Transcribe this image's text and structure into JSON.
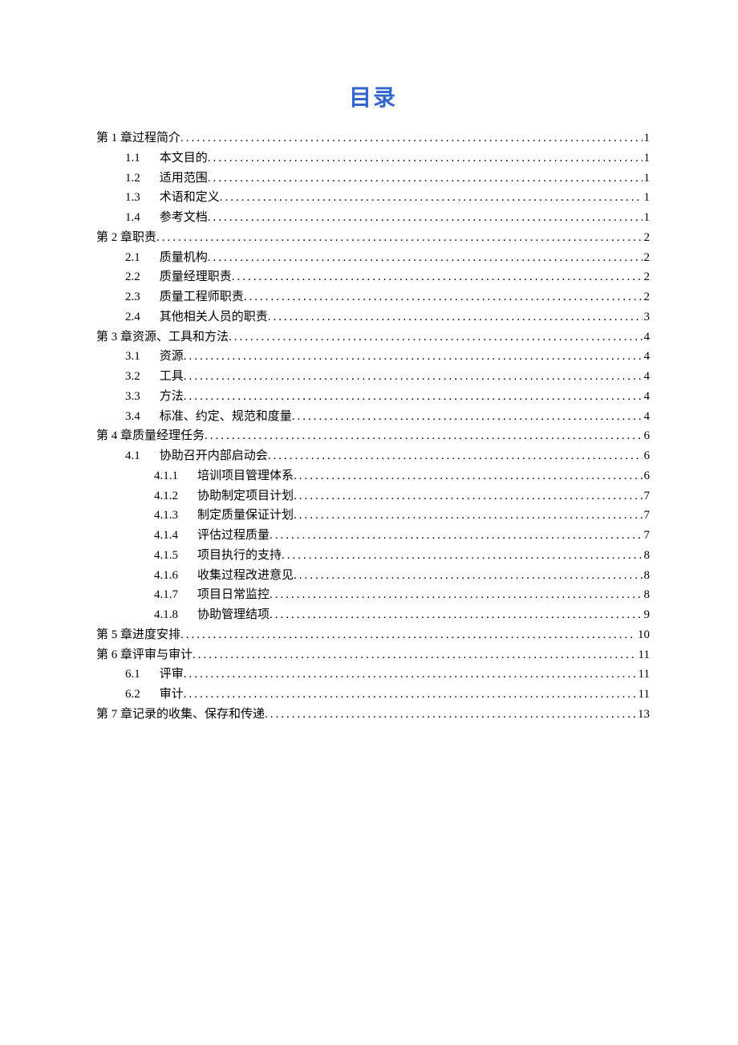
{
  "title": "目录",
  "entries": [
    {
      "level": 1,
      "num": "第 1 章",
      "label": " 过程简介",
      "page": "1"
    },
    {
      "level": 2,
      "num": "1.1",
      "label": "本文目的",
      "page": "1"
    },
    {
      "level": 2,
      "num": "1.2",
      "label": "适用范围",
      "page": "1"
    },
    {
      "level": 2,
      "num": "1.3",
      "label": "术语和定义",
      "page": "1"
    },
    {
      "level": 2,
      "num": "1.4",
      "label": "参考文档",
      "page": "1"
    },
    {
      "level": 1,
      "num": "第 2 章",
      "label": " 职责",
      "page": "2"
    },
    {
      "level": 2,
      "num": "2.1",
      "label": "质量机构",
      "page": "2"
    },
    {
      "level": 2,
      "num": "2.2",
      "label": "质量经理职责",
      "page": "2"
    },
    {
      "level": 2,
      "num": "2.3",
      "label": "质量工程师职责",
      "page": "2"
    },
    {
      "level": 2,
      "num": "2.4",
      "label": "其他相关人员的职责",
      "page": "3"
    },
    {
      "level": 1,
      "num": "第 3 章",
      "label": " 资源、工具和方法",
      "page": "4"
    },
    {
      "level": 2,
      "num": "3.1",
      "label": "资源",
      "page": "4"
    },
    {
      "level": 2,
      "num": "3.2",
      "label": "工具",
      "page": "4"
    },
    {
      "level": 2,
      "num": "3.3",
      "label": "方法",
      "page": "4"
    },
    {
      "level": 2,
      "num": "3.4",
      "label": "标准、约定、规范和度量",
      "page": "4"
    },
    {
      "level": 1,
      "num": "第 4 章",
      "label": " 质量经理任务",
      "page": "6"
    },
    {
      "level": 2,
      "num": "4.1",
      "label": "协助召开内部启动会",
      "page": "6"
    },
    {
      "level": 3,
      "num": "4.1.1",
      "label": "培训项目管理体系",
      "page": "6"
    },
    {
      "level": 3,
      "num": "4.1.2",
      "label": "协助制定项目计划",
      "page": "7"
    },
    {
      "level": 3,
      "num": "4.1.3",
      "label": "制定质量保证计划",
      "page": "7"
    },
    {
      "level": 3,
      "num": "4.1.4",
      "label": "评估过程质量",
      "page": "7"
    },
    {
      "level": 3,
      "num": "4.1.5",
      "label": "项目执行的支持",
      "page": "8"
    },
    {
      "level": 3,
      "num": "4.1.6",
      "label": "收集过程改进意见",
      "page": "8"
    },
    {
      "level": 3,
      "num": "4.1.7",
      "label": "项目日常监控",
      "page": "8"
    },
    {
      "level": 3,
      "num": "4.1.8",
      "label": "协助管理结项",
      "page": "9"
    },
    {
      "level": 1,
      "num": "第 5 章",
      "label": " 进度安排",
      "page": "10"
    },
    {
      "level": 1,
      "num": "第 6 章",
      "label": " 评审与审计",
      "page": "11"
    },
    {
      "level": 2,
      "num": "6.1",
      "label": "评审",
      "page": "11"
    },
    {
      "level": 2,
      "num": "6.2",
      "label": "审计",
      "page": "11"
    },
    {
      "level": 1,
      "num": "第 7 章",
      "label": " 记录的收集、保存和传递",
      "page": "13"
    }
  ]
}
